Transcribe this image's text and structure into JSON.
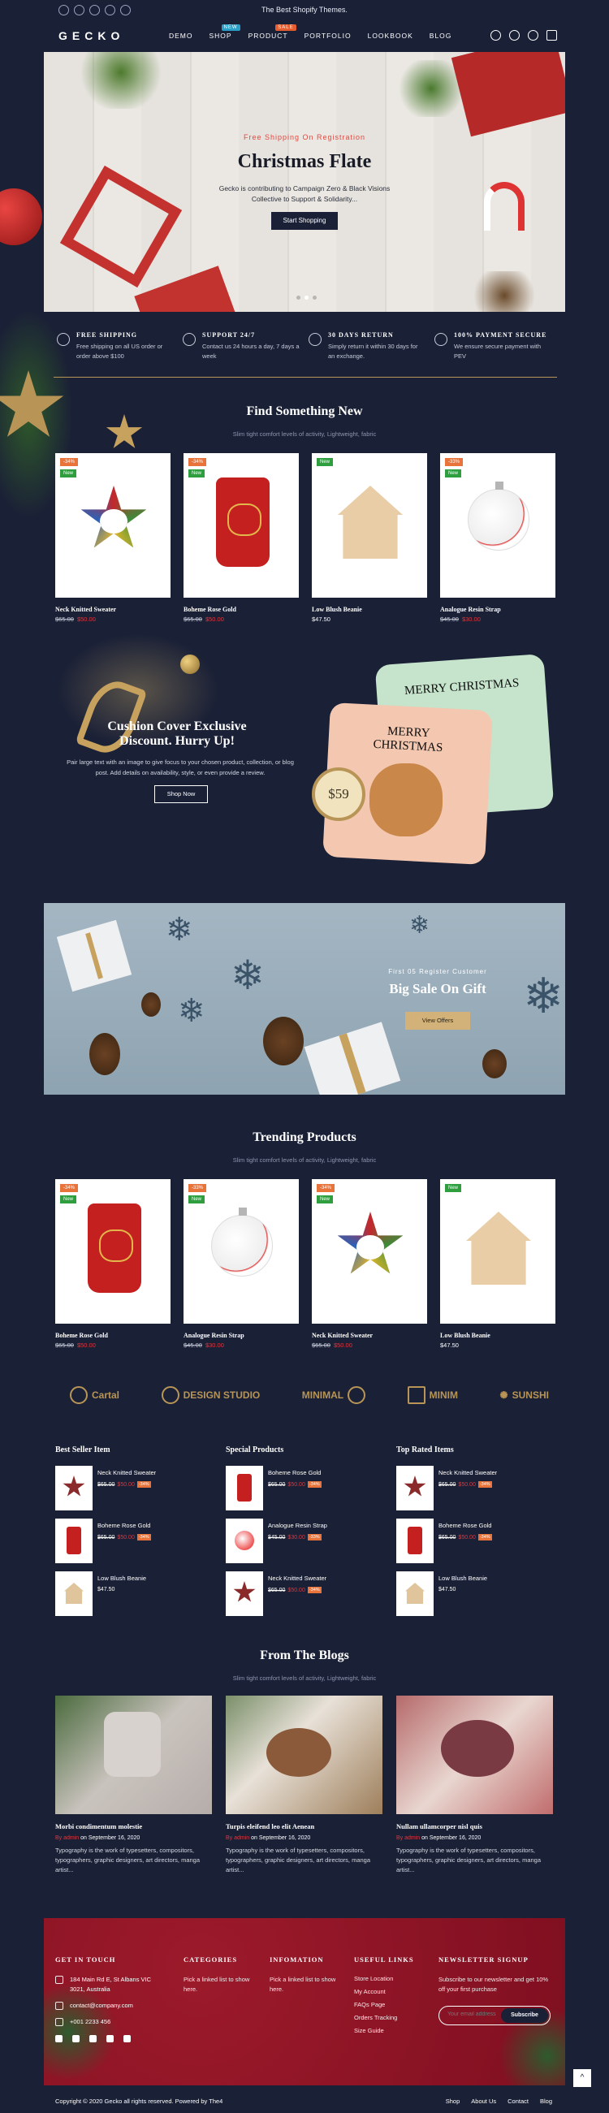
{
  "topbar": {
    "promo": "The Best Shopify Themes.",
    "social": [
      "facebook",
      "twitter",
      "instagram",
      "pinterest",
      "youtube"
    ]
  },
  "header": {
    "logo": "GECKO",
    "nav": [
      {
        "label": "DEMO",
        "badge": ""
      },
      {
        "label": "SHOP",
        "badge": "NEW"
      },
      {
        "label": "PRODUCT",
        "badge": "SALE"
      },
      {
        "label": "PORTFOLIO",
        "badge": ""
      },
      {
        "label": "LOOKBOOK",
        "badge": ""
      },
      {
        "label": "BLOG",
        "badge": ""
      }
    ],
    "icons": [
      "search-icon",
      "user-icon",
      "heart-icon",
      "cart-icon"
    ]
  },
  "hero": {
    "subtitle": "Free Shipping On Registration",
    "title": "Christmas Flate",
    "description": "Gecko is contributing to Campaign Zero & Black Visions Collective to Support & Solidarity...",
    "button": "Start Shopping",
    "slides": 3,
    "active_slide": 2
  },
  "features": [
    {
      "title": "FREE SHIPPING",
      "desc": "Free shipping on all US order or order above $100"
    },
    {
      "title": "SUPPORT 24/7",
      "desc": "Contact us 24 hours a day, 7 days a week"
    },
    {
      "title": "30 DAYS RETURN",
      "desc": "Simply return it within 30 days for an exchange."
    },
    {
      "title": "100% PAYMENT SECURE",
      "desc": "We ensure secure payment with PEV"
    }
  ],
  "new_section": {
    "title": "Find Something New",
    "subtitle": "Slim tight comfort levels of activity, Lightweight, fabric",
    "products": [
      {
        "name": "Neck Knitted Sweater",
        "old_price": "$65.00",
        "price": "$50.00",
        "sale": "-34%",
        "new": "New",
        "img": "star"
      },
      {
        "name": "Boheme Rose Gold",
        "old_price": "$65.00",
        "price": "$50.00",
        "sale": "-34%",
        "new": "New",
        "img": "bag"
      },
      {
        "name": "Low Blush Beanie",
        "old_price": "",
        "price": "$47.50",
        "sale": "",
        "new": "New",
        "img": "house"
      },
      {
        "name": "Analogue Resin Strap",
        "old_price": "$45.00",
        "price": "$30.00",
        "sale": "-33%",
        "new": "New",
        "img": "bauble"
      }
    ]
  },
  "cushion": {
    "title": "Cushion Cover Exclusive Discount. Hurry Up!",
    "description": "Pair large text with an image to give focus to your chosen product, collection, or blog post. Add details on availability, style, or even provide a review.",
    "button": "Shop Now",
    "price": "$59",
    "pillow_text_1": "MERRY CHRISTMAS",
    "pillow_text_2": "MERRY CHRISTMAS"
  },
  "sale_banner": {
    "subtitle": "First 05 Register Customer",
    "title": "Big Sale On Gift",
    "button": "View Offers"
  },
  "trending": {
    "title": "Trending Products",
    "subtitle": "Slim tight comfort levels of activity, Lightweight, fabric",
    "products": [
      {
        "name": "Boheme Rose Gold",
        "old_price": "$65.00",
        "price": "$50.00",
        "sale": "-34%",
        "new": "New",
        "img": "bag"
      },
      {
        "name": "Analogue Resin Strap",
        "old_price": "$45.00",
        "price": "$30.00",
        "sale": "-33%",
        "new": "New",
        "img": "bauble"
      },
      {
        "name": "Neck Knitted Sweater",
        "old_price": "$65.00",
        "price": "$50.00",
        "sale": "-34%",
        "new": "New",
        "img": "star"
      },
      {
        "name": "Low Blush Beanie",
        "old_price": "",
        "price": "$47.50",
        "sale": "",
        "new": "New",
        "img": "house"
      }
    ]
  },
  "brands": [
    "Cartal",
    "DESIGN STUDIO",
    "MINIMAL",
    "MINIM",
    "SUNSHI"
  ],
  "lists": [
    {
      "title": "Best Seller Item",
      "items": [
        {
          "name": "Neck Knitted Sweater",
          "old": "$65.00",
          "new": "$50.00",
          "off": "-34%",
          "img": "star"
        },
        {
          "name": "Boheme Rose Gold",
          "old": "$65.00",
          "new": "$50.00",
          "off": "-34%",
          "img": "bag"
        },
        {
          "name": "Low Blush Beanie",
          "old": "",
          "new": "$47.50",
          "off": "",
          "img": "house"
        }
      ]
    },
    {
      "title": "Special Products",
      "items": [
        {
          "name": "Boheme Rose Gold",
          "old": "$65.00",
          "new": "$50.00",
          "off": "-34%",
          "img": "bag"
        },
        {
          "name": "Analogue Resin Strap",
          "old": "$45.00",
          "new": "$30.00",
          "off": "-33%",
          "img": "bauble"
        },
        {
          "name": "Neck Knitted Sweater",
          "old": "$65.00",
          "new": "$50.00",
          "off": "-34%",
          "img": "star"
        }
      ]
    },
    {
      "title": "Top Rated Items",
      "items": [
        {
          "name": "Neck Knitted Sweater",
          "old": "$65.00",
          "new": "$50.00",
          "off": "-34%",
          "img": "star"
        },
        {
          "name": "Boheme Rose Gold",
          "old": "$65.00",
          "new": "$50.00",
          "off": "-34%",
          "img": "bag"
        },
        {
          "name": "Low Blush Beanie",
          "old": "",
          "new": "$47.50",
          "off": "",
          "img": "house"
        }
      ]
    }
  ],
  "blogs": {
    "title": "From The Blogs",
    "subtitle": "Slim tight comfort levels of activity, Lightweight, fabric",
    "posts": [
      {
        "title": "Morbi condimentum molestie",
        "author": "By admin",
        "date": "on September 16, 2020",
        "excerpt": "Typography is the work of typesetters, compositors, typographers, graphic designers, art directors, manga artist..."
      },
      {
        "title": "Turpis eleifend leo elit Aenean",
        "author": "By admin",
        "date": "on September 16, 2020",
        "excerpt": "Typography is the work of typesetters, compositors, typographers, graphic designers, art directors, manga artist..."
      },
      {
        "title": "Nullam ullamcorper nisl quis",
        "author": "By admin",
        "date": "on September 16, 2020",
        "excerpt": "Typography is the work of typesetters, compositors, typographers, graphic designers, art directors, manga artist..."
      }
    ]
  },
  "footer": {
    "get_in_touch": {
      "title": "GET IN TOUCH",
      "address": "184 Main Rd E, St Albans VIC 3021, Australia",
      "email": "contact@company.com",
      "phone": "+001 2233 456"
    },
    "categories": {
      "title": "CATEGORIES",
      "text": "Pick a linked list to show here."
    },
    "information": {
      "title": "INFOMATION",
      "text": "Pick a linked list to show here."
    },
    "useful_links": {
      "title": "USEFUL LINKS",
      "links": [
        "Store Location",
        "My Account",
        "FAQs Page",
        "Orders Tracking",
        "Size Guide"
      ]
    },
    "newsletter": {
      "title": "NEWSLETTER SIGNUP",
      "text": "Subscribe to our newsletter and get 10% off your first purchase",
      "placeholder": "Your email address",
      "button": "Subscribe"
    },
    "copyright": "Copyright © 2020 Gecko all rights reserved. Powered by The4",
    "bottom_nav": [
      "Shop",
      "About Us",
      "Contact",
      "Blog"
    ]
  },
  "colors": {
    "background": "#1a2036",
    "accent_gold": "#b89556",
    "sale_red": "#e2353c",
    "footer_red": "#8c1426"
  }
}
